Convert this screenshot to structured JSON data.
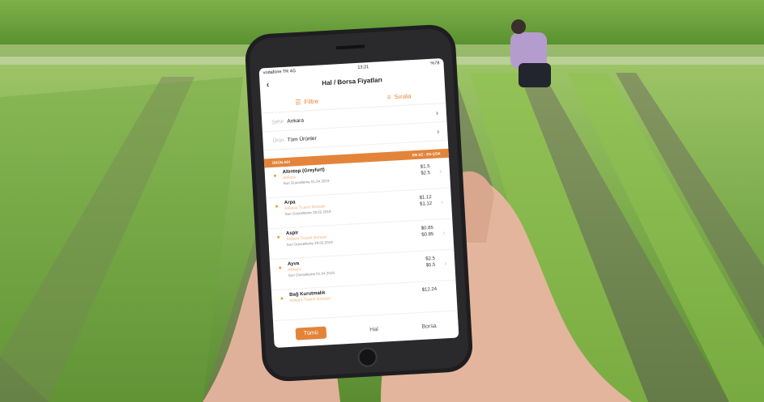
{
  "status_bar": {
    "carrier": "vodafone TR  4G",
    "time": "13:21",
    "battery": "%78"
  },
  "header": {
    "title": "Hal / Borsa Fiyatları",
    "back_icon": "chevron-left-icon"
  },
  "filters": {
    "filter_label": "Filtre",
    "sort_label": "Sırala"
  },
  "city_row": {
    "label": "Şehir",
    "value": "Ankara"
  },
  "product_row": {
    "label": "Ürün",
    "value": "Tüm Ürünler"
  },
  "list_header": {
    "left": "ÜRÜN ADI",
    "right": "EN AZ - EN ÇOK"
  },
  "items": [
    {
      "name": "Altıntop (Greyfurt)",
      "sub": "Ankara",
      "date": "Son Güncelleme 01.04.2019",
      "p1": "$1.5",
      "p2": "$2.5"
    },
    {
      "name": "Arpa",
      "sub": "Ankara Ticaret Borsası",
      "date": "Son Güncelleme 28.02.2019",
      "p1": "$1.12",
      "p2": "$1.12"
    },
    {
      "name": "Aspir",
      "sub": "Ankara Ticaret Borsası",
      "date": "Son Güncelleme 29.03.2019",
      "p1": "$0.85",
      "p2": "$0.85"
    },
    {
      "name": "Ayva",
      "sub": "Ankara",
      "date": "Son Güncelleme 01.04.2019",
      "p1": "$2.5",
      "p2": "$5.5"
    },
    {
      "name": "Bağ Kurutmalık",
      "sub": "Ankara Ticaret Borsası",
      "date": "",
      "p1": "$12.24",
      "p2": ""
    }
  ],
  "tabs": {
    "all": "Tümü",
    "hal": "Hal",
    "borsa": "Borsa"
  },
  "colors": {
    "accent": "#e3843a",
    "field_green": "#6fa63a",
    "soil": "#6e6a5e"
  }
}
